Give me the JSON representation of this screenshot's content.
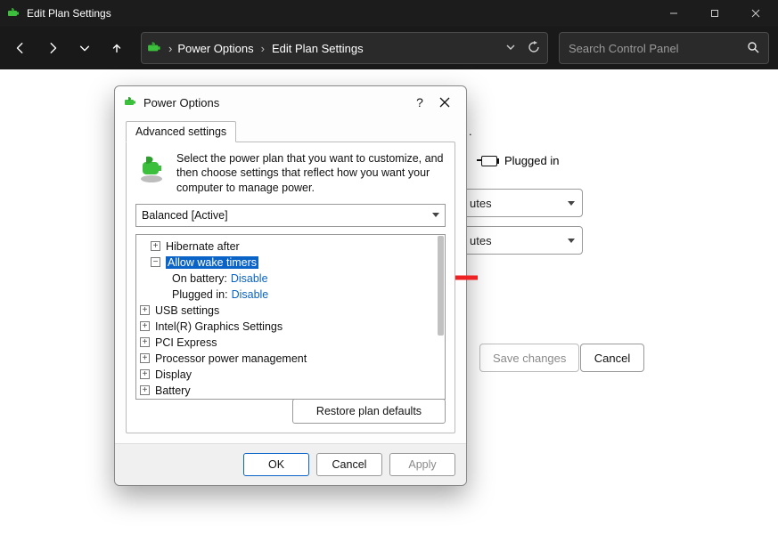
{
  "window": {
    "title": "Edit Plan Settings"
  },
  "toolbar": {
    "breadcrumb1": "Power Options",
    "breadcrumb2": "Edit Plan Settings",
    "search_placeholder": "Search Control Panel"
  },
  "background": {
    "truncated_period": ".",
    "plugged_in": "Plugged in",
    "time_suffix": "utes",
    "save_changes": "Save changes",
    "cancel": "Cancel"
  },
  "dialog": {
    "title": "Power Options",
    "tab_label": "Advanced settings",
    "intro": "Select the power plan that you want to customize, and then choose settings that reflect how you want your computer to manage power.",
    "combo_selected": "Balanced [Active]",
    "restore_label": "Restore plan defaults",
    "buttons": {
      "ok": "OK",
      "cancel": "Cancel",
      "apply": "Apply"
    },
    "tree": {
      "hibernate_after": "Hibernate after",
      "allow_wake_timers": "Allow wake timers",
      "on_battery_label": "On battery:",
      "on_battery_value": "Disable",
      "plugged_in_label": "Plugged in:",
      "plugged_in_value": "Disable",
      "usb_settings": "USB settings",
      "intel_graphics": "Intel(R) Graphics Settings",
      "pci_express": "PCI Express",
      "processor_power": "Processor power management",
      "display": "Display",
      "battery": "Battery"
    }
  }
}
